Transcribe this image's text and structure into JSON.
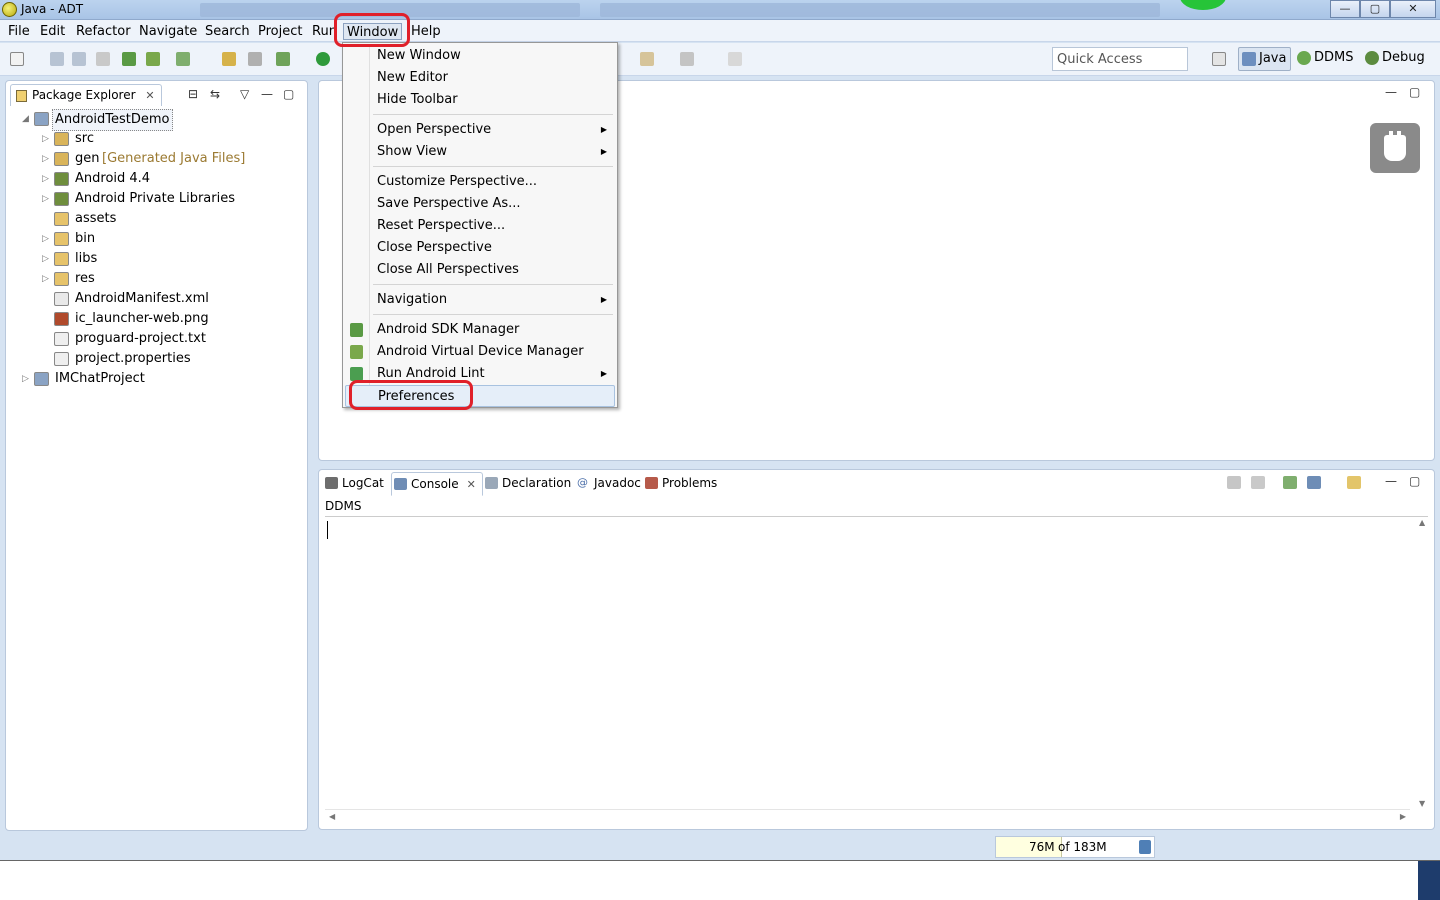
{
  "window": {
    "title": "Java - ADT",
    "buttons": {
      "minimize": "—",
      "maximize": "▢",
      "close": "✕"
    }
  },
  "menubar": {
    "items": [
      "File",
      "Edit",
      "Refactor",
      "Navigate",
      "Search",
      "Project",
      "Run",
      "Window",
      "Help"
    ],
    "active": "Window"
  },
  "toolbar": {
    "quick_access_placeholder": "Quick Access",
    "perspectives": [
      "Java",
      "DDMS",
      "Debug"
    ],
    "active_perspective": "Java"
  },
  "package_explorer": {
    "tab_label": "Package Explorer",
    "close_label": "✕",
    "tree": [
      {
        "label": "AndroidTestDemo",
        "level": 0,
        "expanded": true,
        "selected": true,
        "icon": "project-icon"
      },
      {
        "label": "src",
        "level": 1,
        "expanded": false,
        "icon": "package-folder-icon"
      },
      {
        "label": "gen",
        "extra": "[Generated Java Files]",
        "level": 1,
        "expanded": false,
        "icon": "package-folder-icon"
      },
      {
        "label": "Android 4.4",
        "level": 1,
        "expanded": false,
        "icon": "library-icon"
      },
      {
        "label": "Android Private Libraries",
        "level": 1,
        "expanded": false,
        "icon": "library-icon"
      },
      {
        "label": "assets",
        "level": 1,
        "expanded": null,
        "icon": "folder-icon"
      },
      {
        "label": "bin",
        "level": 1,
        "expanded": false,
        "icon": "folder-icon"
      },
      {
        "label": "libs",
        "level": 1,
        "expanded": false,
        "icon": "folder-icon"
      },
      {
        "label": "res",
        "level": 1,
        "expanded": false,
        "icon": "folder-icon"
      },
      {
        "label": "AndroidManifest.xml",
        "level": 1,
        "expanded": null,
        "icon": "xml-file-icon"
      },
      {
        "label": "ic_launcher-web.png",
        "level": 1,
        "expanded": null,
        "icon": "image-file-icon"
      },
      {
        "label": "proguard-project.txt",
        "level": 1,
        "expanded": null,
        "icon": "text-file-icon"
      },
      {
        "label": "project.properties",
        "level": 1,
        "expanded": null,
        "icon": "text-file-icon"
      },
      {
        "label": "IMChatProject",
        "level": 0,
        "expanded": false,
        "icon": "project-icon"
      }
    ]
  },
  "window_menu": {
    "items": [
      {
        "label": "New Window",
        "submenu": false
      },
      {
        "label": "New Editor",
        "submenu": false
      },
      {
        "label": "Hide Toolbar",
        "submenu": false
      },
      {
        "separator": true
      },
      {
        "label": "Open Perspective",
        "submenu": true
      },
      {
        "label": "Show View",
        "submenu": true
      },
      {
        "separator": true
      },
      {
        "label": "Customize Perspective...",
        "submenu": false
      },
      {
        "label": "Save Perspective As...",
        "submenu": false
      },
      {
        "label": "Reset Perspective...",
        "submenu": false
      },
      {
        "label": "Close Perspective",
        "submenu": false
      },
      {
        "label": "Close All Perspectives",
        "submenu": false
      },
      {
        "separator": true
      },
      {
        "label": "Navigation",
        "submenu": true
      },
      {
        "separator": true
      },
      {
        "label": "Android SDK Manager",
        "submenu": false,
        "icon": "sdk-manager-icon"
      },
      {
        "label": "Android Virtual Device Manager",
        "submenu": false,
        "icon": "avd-manager-icon"
      },
      {
        "label": "Run Android Lint",
        "submenu": true,
        "icon": "lint-check-icon"
      },
      {
        "label": "Preferences",
        "submenu": false,
        "highlighted": true
      }
    ]
  },
  "bottom_panel": {
    "tabs": [
      {
        "label": "LogCat",
        "icon": "logcat-icon"
      },
      {
        "label": "Console",
        "icon": "console-icon",
        "active": true
      },
      {
        "label": "Declaration",
        "icon": "declaration-icon"
      },
      {
        "label": "Javadoc",
        "icon": "javadoc-icon"
      },
      {
        "label": "Problems",
        "icon": "problems-icon"
      }
    ],
    "close_label": "✕",
    "console_name": "DDMS"
  },
  "status": {
    "heap_used": "76M",
    "heap_total": "of 183M",
    "heap_used_fraction": 0.42
  },
  "colors": {
    "highlight_red": "#e0202a",
    "window_bg": "#d6e3f2",
    "menu_hover": "#e5eef9"
  }
}
